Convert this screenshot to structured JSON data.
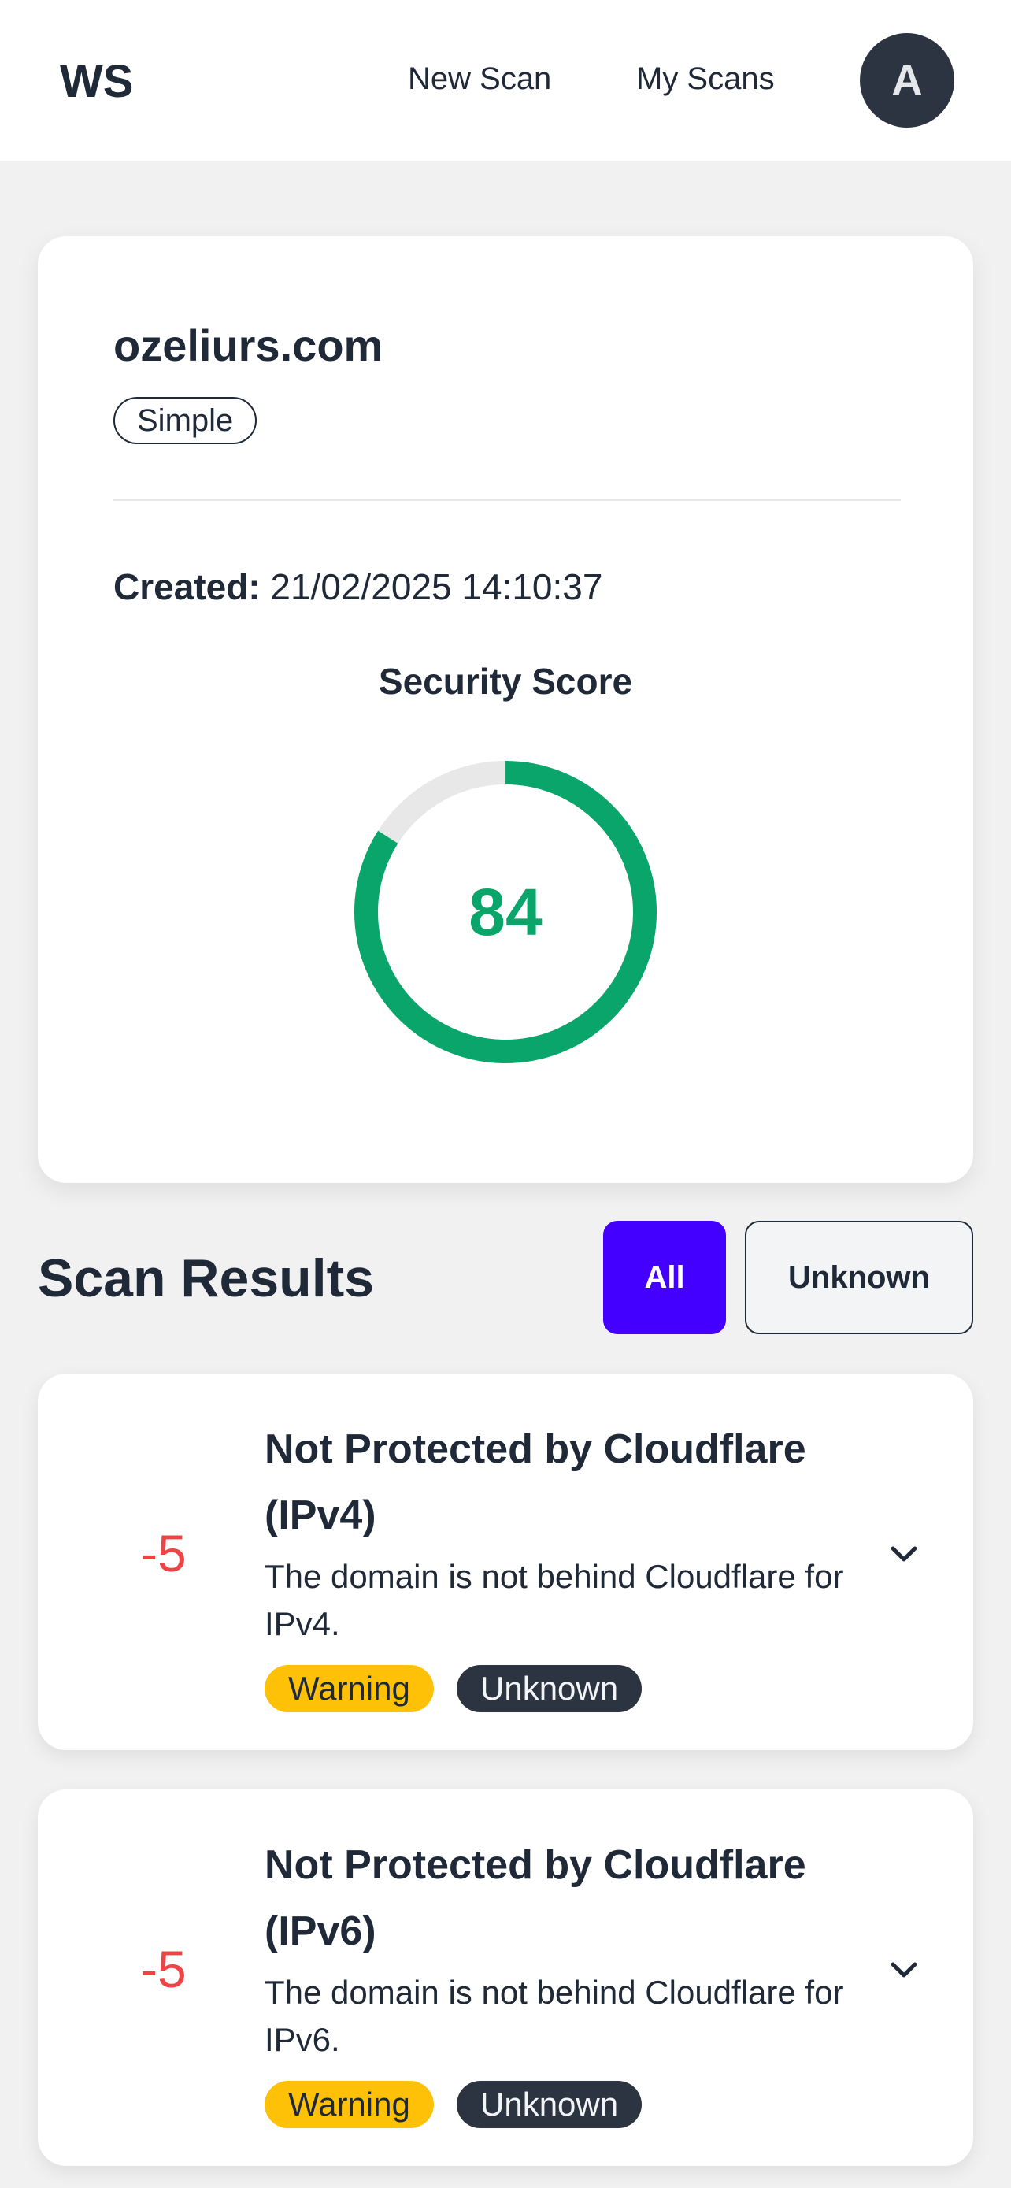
{
  "header": {
    "logo": "WS",
    "nav": {
      "new_scan": "New Scan",
      "my_scans": "My Scans"
    },
    "avatar_initial": "A"
  },
  "scan": {
    "domain": "ozeliurs.com",
    "type": "Simple",
    "created_label": "Created:",
    "created_value": "21/02/2025 14:10:37",
    "score_title": "Security Score",
    "score": "84",
    "score_fraction": 0.84
  },
  "results": {
    "title": "Scan Results",
    "filters": {
      "all": "All",
      "unknown": "Unknown"
    },
    "items": [
      {
        "points": "-5",
        "title": "Not Protected by Cloudflare (IPv4)",
        "description": "The domain is not behind Cloudflare for IPv4.",
        "severity": "Warning",
        "category": "Unknown"
      },
      {
        "points": "-5",
        "title": "Not Protected by Cloudflare (IPv6)",
        "description": "The domain is not behind Cloudflare for IPv6.",
        "severity": "Warning",
        "category": "Unknown"
      }
    ]
  },
  "colors": {
    "score_green": "#0aa56a",
    "track_grey": "#e8e8e8",
    "accent_purple": "#4300ff",
    "points_red": "#ef4444",
    "warning_yellow": "#ffc107",
    "dark_badge": "#2d3441"
  },
  "icons": {
    "expand": "chevron-down-icon"
  }
}
